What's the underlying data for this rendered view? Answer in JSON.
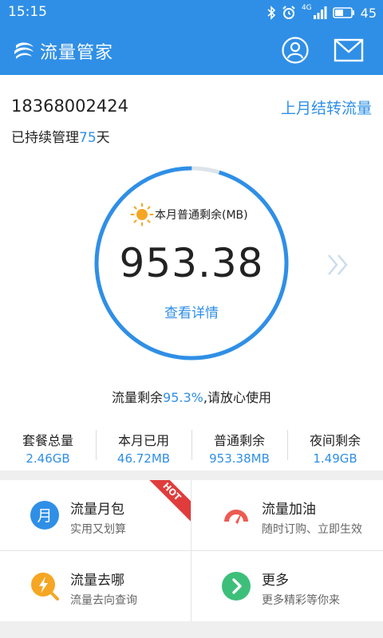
{
  "status_bar": {
    "time": "15:15",
    "battery": "45",
    "network": "4G",
    "icons": [
      "bluetooth-icon",
      "alarm-icon",
      "signal-icon",
      "battery-icon"
    ]
  },
  "app_bar": {
    "title": "流量管家",
    "icons": [
      "china-mobile-logo",
      "user-icon",
      "mail-icon"
    ]
  },
  "account": {
    "phone": "18368002424",
    "managed_prefix": "已持续管理",
    "managed_days": "75",
    "managed_suffix": "天",
    "carry_over_link": "上月结转流量"
  },
  "usage_ring": {
    "label": "本月普通剩余(MB)",
    "remaining": "953.38",
    "detail_link": "查看详情",
    "remaining_fraction": 0.953
  },
  "summary": {
    "prefix": "流量剩余",
    "percent": "95.3%",
    "suffix": ",请放心使用"
  },
  "stats": [
    {
      "label": "套餐总量",
      "value": "2.46GB"
    },
    {
      "label": "本月已用",
      "value": "46.72MB"
    },
    {
      "label": "普通剩余",
      "value": "953.38MB"
    },
    {
      "label": "夜间剩余",
      "value": "1.49GB"
    }
  ],
  "tiles": [
    {
      "title": "流量月包",
      "subtitle": "实用又划算",
      "icon": "month-package-icon",
      "icon_text": "月",
      "badge": "HOT"
    },
    {
      "title": "流量加油",
      "subtitle": "随时订购、立即生效",
      "icon": "speedometer-icon"
    },
    {
      "title": "流量去哪",
      "subtitle": "流量去向查询",
      "icon": "lightning-search-icon"
    },
    {
      "title": "更多",
      "subtitle": "更多精彩等你来",
      "icon": "chevron-right-icon"
    }
  ],
  "colors": {
    "accent": "#2f8fe6",
    "ring_track": "#dde3ea",
    "hot_badge": "#e03c3c",
    "tile_month": "#2f8fe6",
    "tile_refuel": "#ee5a52",
    "tile_where": "#f5a623",
    "tile_more": "#3dbf7a"
  }
}
